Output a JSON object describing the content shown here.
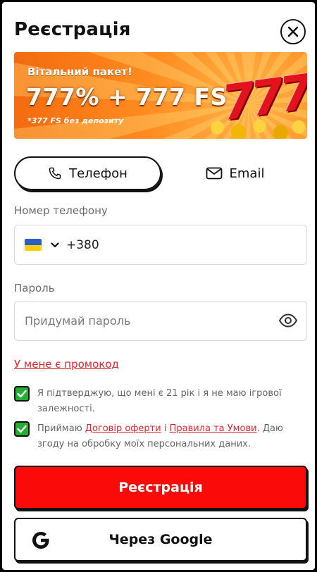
{
  "header": {
    "title": "Реєстрація"
  },
  "banner": {
    "line1": "Вітальний пакет!",
    "line2": "777% + 777 FS",
    "line3": "*377 FS без депозиту",
    "graphic": "777"
  },
  "tabs": [
    {
      "label": "Телефон",
      "icon": "phone-icon",
      "active": true
    },
    {
      "label": "Email",
      "icon": "envelope-icon",
      "active": false
    }
  ],
  "phone": {
    "label": "Номер телефону",
    "country_flag": "ukraine-flag",
    "code": "+380"
  },
  "password": {
    "label": "Пароль",
    "placeholder": "Придумай пароль"
  },
  "promo_link": "У мене є промокод",
  "consents": {
    "age": {
      "checked": true,
      "text": "Я підтверджую, що мені є 21 рік і я не маю ігрової залежності."
    },
    "terms": {
      "checked": true,
      "prefix": "Приймаю ",
      "offer_link": "Договір оферти",
      "middle": " і ",
      "rules_link": "Правила та Умови",
      "suffix": ". Даю згоду на обробку моїх персональних даних."
    }
  },
  "buttons": {
    "register": "Реєстрація",
    "google": "Через Google"
  },
  "colors": {
    "accent_red": "#fb0a0a",
    "link_red": "#e0262d",
    "check_green": "#23b031"
  }
}
